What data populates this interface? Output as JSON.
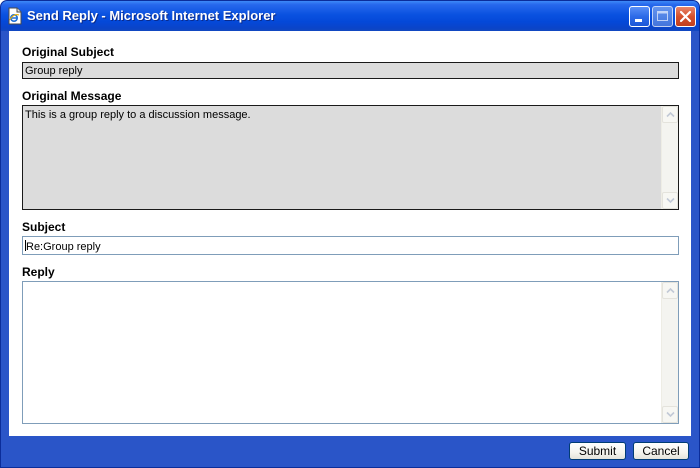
{
  "window": {
    "title": "Send Reply - Microsoft Internet Explorer"
  },
  "form": {
    "original_subject_label": "Original Subject",
    "original_subject_value": "Group reply",
    "original_message_label": "Original Message",
    "original_message_value": "This is a group reply to a discussion message.",
    "subject_label": "Subject",
    "subject_value": "Re:Group reply",
    "reply_label": "Reply",
    "reply_value": ""
  },
  "buttons": {
    "submit": "Submit",
    "cancel": "Cancel"
  },
  "icons": {
    "app": "ie-page-icon",
    "minimize": "minimize-icon",
    "maximize": "maximize-icon",
    "close": "close-icon",
    "scroll_up": "arrow-up-icon",
    "scroll_down": "arrow-down-icon"
  },
  "colors": {
    "titlebar": "#0a52e0",
    "frame": "#2a55c8",
    "readonly_bg": "#dcdcdc",
    "input_border": "#7f9db9",
    "close_button": "#d5502c"
  }
}
